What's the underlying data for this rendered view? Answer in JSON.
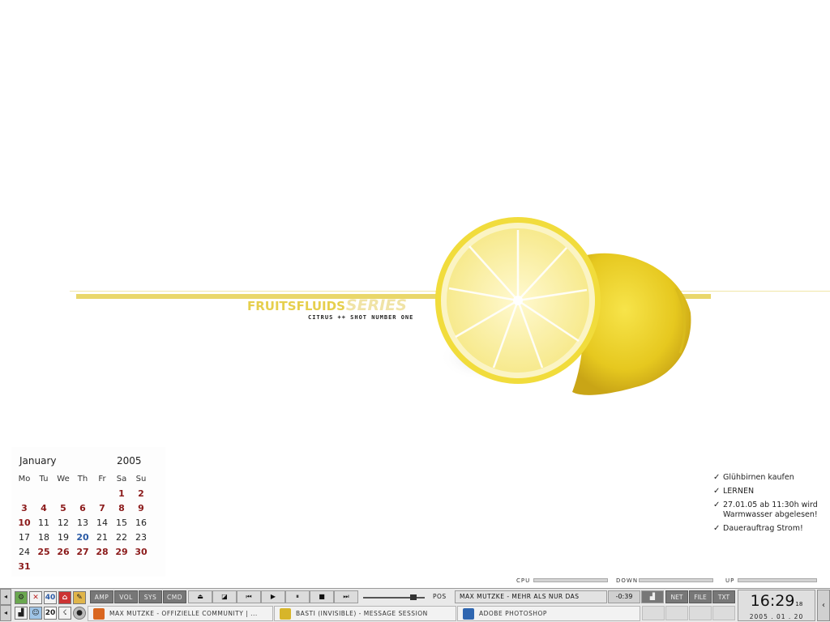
{
  "wallpaper": {
    "brand_main": "FRUITSFLUIDS",
    "brand_series": "SERIES",
    "subtitle": "CITRUS ++ SHOT NUMBER ONE"
  },
  "calendar": {
    "month": "January",
    "year": "2005",
    "weekdays": [
      "Mo",
      "Tu",
      "We",
      "Th",
      "Fr",
      "Sa",
      "Su"
    ],
    "days": [
      {
        "d": "",
        "s": ""
      },
      {
        "d": "",
        "s": ""
      },
      {
        "d": "",
        "s": ""
      },
      {
        "d": "",
        "s": ""
      },
      {
        "d": "",
        "s": ""
      },
      {
        "d": "1",
        "s": "red"
      },
      {
        "d": "2",
        "s": "red"
      },
      {
        "d": "3",
        "s": "red"
      },
      {
        "d": "4",
        "s": "red"
      },
      {
        "d": "5",
        "s": "red"
      },
      {
        "d": "6",
        "s": "red"
      },
      {
        "d": "7",
        "s": "red"
      },
      {
        "d": "8",
        "s": "red"
      },
      {
        "d": "9",
        "s": "red"
      },
      {
        "d": "10",
        "s": "red"
      },
      {
        "d": "11",
        "s": ""
      },
      {
        "d": "12",
        "s": ""
      },
      {
        "d": "13",
        "s": ""
      },
      {
        "d": "14",
        "s": ""
      },
      {
        "d": "15",
        "s": ""
      },
      {
        "d": "16",
        "s": ""
      },
      {
        "d": "17",
        "s": ""
      },
      {
        "d": "18",
        "s": ""
      },
      {
        "d": "19",
        "s": ""
      },
      {
        "d": "20",
        "s": "today"
      },
      {
        "d": "21",
        "s": ""
      },
      {
        "d": "22",
        "s": ""
      },
      {
        "d": "23",
        "s": ""
      },
      {
        "d": "24",
        "s": ""
      },
      {
        "d": "25",
        "s": "red"
      },
      {
        "d": "26",
        "s": "red"
      },
      {
        "d": "27",
        "s": "red"
      },
      {
        "d": "28",
        "s": "red"
      },
      {
        "d": "29",
        "s": "red"
      },
      {
        "d": "30",
        "s": "red"
      },
      {
        "d": "31",
        "s": "red"
      }
    ]
  },
  "todo": {
    "items": [
      "Glühbirnen kaufen",
      "LERNEN",
      "27.01.05   ab 11:30h wird Warmwasser abgelesen!",
      "Dauerauftrag Strom!"
    ]
  },
  "meters": {
    "cpu": "CPU",
    "down": "DOWN",
    "up": "UP"
  },
  "taskbar": {
    "player_tabs": [
      "AMP",
      "VOL",
      "SYS",
      "CMD"
    ],
    "controls": [
      "eject",
      "open",
      "prev",
      "play",
      "pause",
      "stop",
      "next"
    ],
    "control_glyphs": [
      "⏏",
      "◪",
      "⏮",
      "▶",
      "⏸",
      "■",
      "⏭"
    ],
    "position": 0.82,
    "pos_label": "POS",
    "song_title": "MAX MUTZKE - MEHR ALS NUR DAS",
    "time_remaining": "-0:39",
    "sys_buttons": [
      "NET",
      "FILE",
      "TXT"
    ],
    "tasks": [
      {
        "label": "MAX MUTZKE - OFFIZIELLE COMMUNITY | ...",
        "icon": "firefox-icon",
        "color": "#d9661f"
      },
      {
        "label": "BASTI (INVISIBLE) - MESSAGE SESSION",
        "icon": "messenger-icon",
        "color": "#d7b52a"
      },
      {
        "label": "ADOBE PHOTOSHOP",
        "icon": "photoshop-icon",
        "color": "#2f66b0"
      }
    ],
    "quicklaunch_num_a": "40",
    "quicklaunch_num_b": "20",
    "clock_time": "16:29",
    "clock_seconds": "18",
    "clock_date": "2005 . 01 . 20"
  }
}
